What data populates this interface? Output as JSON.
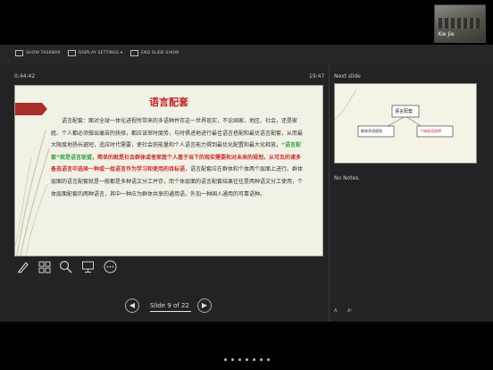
{
  "meeting": {
    "participant_name": "Xie Jie"
  },
  "toolbar": {
    "show_taskbar": "SHOW TASKBAR",
    "display_settings": "DISPLAY SETTINGS ▾",
    "end_slide_show": "END SLIDE SHOW"
  },
  "presenter": {
    "timer": "0:44:42",
    "clock": "19:47",
    "slide_counter": "Slide 9 of 22",
    "next_slide_label": "Next slide",
    "notes": "No Notes."
  },
  "slide": {
    "title": "语言配套",
    "p1": "语言配套：面对全球一体化进程所带来的多语种并存这一世界现实，不论国家、地区、社会，还是家庭、个人都必须做出痛苦的抉择，都应该审时度势，与时俱进地进行最佳语言搭配和最优语言配套，从而最大限度地扬长避短，适应时代需要，使社会获能量和个人语言能力得到最优化配置和最大化释放。",
    "green": "“语言配套”就是语言联盟",
    "r1": "，简单的就是社会群体或者家庭个人基于当下的现实需要和对未来的规划，从可及的诸多备选语言中选择一种或一组语言作为学习和使用的目标语",
    "p2": "，语言配套应在群体和个体两个层面上进行。群体层面的语言配套就是一般都是多种语文分工并存，而个体层面的语言配套结果往往是两种语文分工使用，个体层面配套的两种语言，其中一种应为群体共享的通用语，外加一种国人通用的可靠语种。"
  },
  "next_slide": {
    "top_box": "语言配套",
    "left_box": "群体多语规划",
    "right_box": "个体双语选择"
  },
  "font_controls": {
    "smaller": "A",
    "larger": "A⁺"
  },
  "colors": {
    "accent_red": "#c0282b",
    "accent_green": "#3aa346"
  }
}
